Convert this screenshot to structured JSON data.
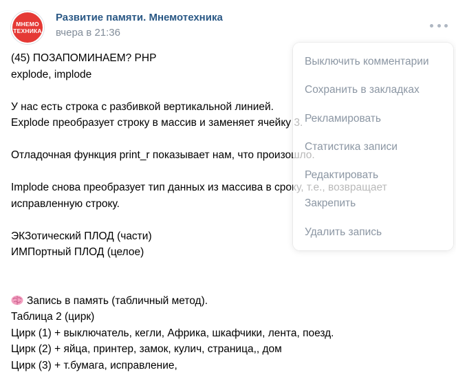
{
  "post": {
    "author": {
      "name": "Развитие памяти. Мнемотехника",
      "avatar_text_line1": "МНЕМО",
      "avatar_text_line2": "ТЕХНИКА"
    },
    "time": "вчера в 21:36",
    "body": {
      "line1": "(45) ПОЗАПОМИНАЕМ? PHP",
      "line2": "explode, implode",
      "line3": "У нас есть строка с разбивкой вертикальной линией.",
      "line4": "Explode преобразует строку в массив и заменяет ячейку 3.",
      "line5": "Отладочная функция print_r показывает нам, что произошло.",
      "line6": "Implode снова преобразует тип данных из массива в сроку, т.е., возвращает",
      "line7": "исправленную строку.",
      "line8": "ЭКЗотический ПЛОД (части)",
      "line9": "ИМПортный ПЛОД (целое)",
      "line10": "Запись в память (табличный метод).",
      "line11": "Таблица 2 (цирк)",
      "line12": "Цирк (1) + выключатель, кегли, Африка, шкафчики, лента, поезд.",
      "line13": "Цирк (2) + яйца, принтер, замок, кулич, страница,, дом",
      "line14": "Цирк (3) + т.бумага, исправление,"
    }
  },
  "menu": {
    "items": [
      "Выключить комментарии",
      "Сохранить в закладках",
      "Рекламировать",
      "Статистика записи",
      "Редактировать",
      "Закрепить",
      "Удалить запись"
    ]
  },
  "colors": {
    "author_link": "#2a5885",
    "secondary_text": "#818c99",
    "menu_text": "#8b96a3",
    "avatar_bg": "#e53935",
    "brain_icon": "#f2a0c0"
  },
  "icons": {
    "more": "more-horizontal-icon",
    "brain": "brain-icon"
  }
}
